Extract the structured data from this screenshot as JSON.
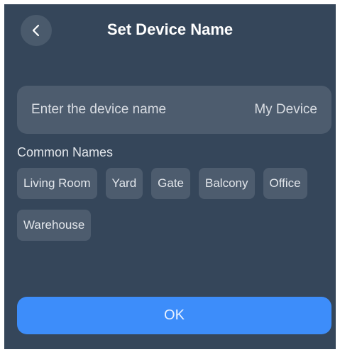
{
  "header": {
    "title": "Set Device Name",
    "back_icon": "chevron-left-icon"
  },
  "name_field": {
    "label": "Enter the device name",
    "value": "My Device"
  },
  "common_names": {
    "label": "Common Names",
    "items": [
      "Living Room",
      "Yard",
      "Gate",
      "Balcony",
      "Office",
      "Warehouse"
    ]
  },
  "confirm": {
    "label": "OK"
  },
  "colors": {
    "background": "#35465a",
    "field": "#4d5c6e",
    "accent": "#3d8dfa"
  }
}
